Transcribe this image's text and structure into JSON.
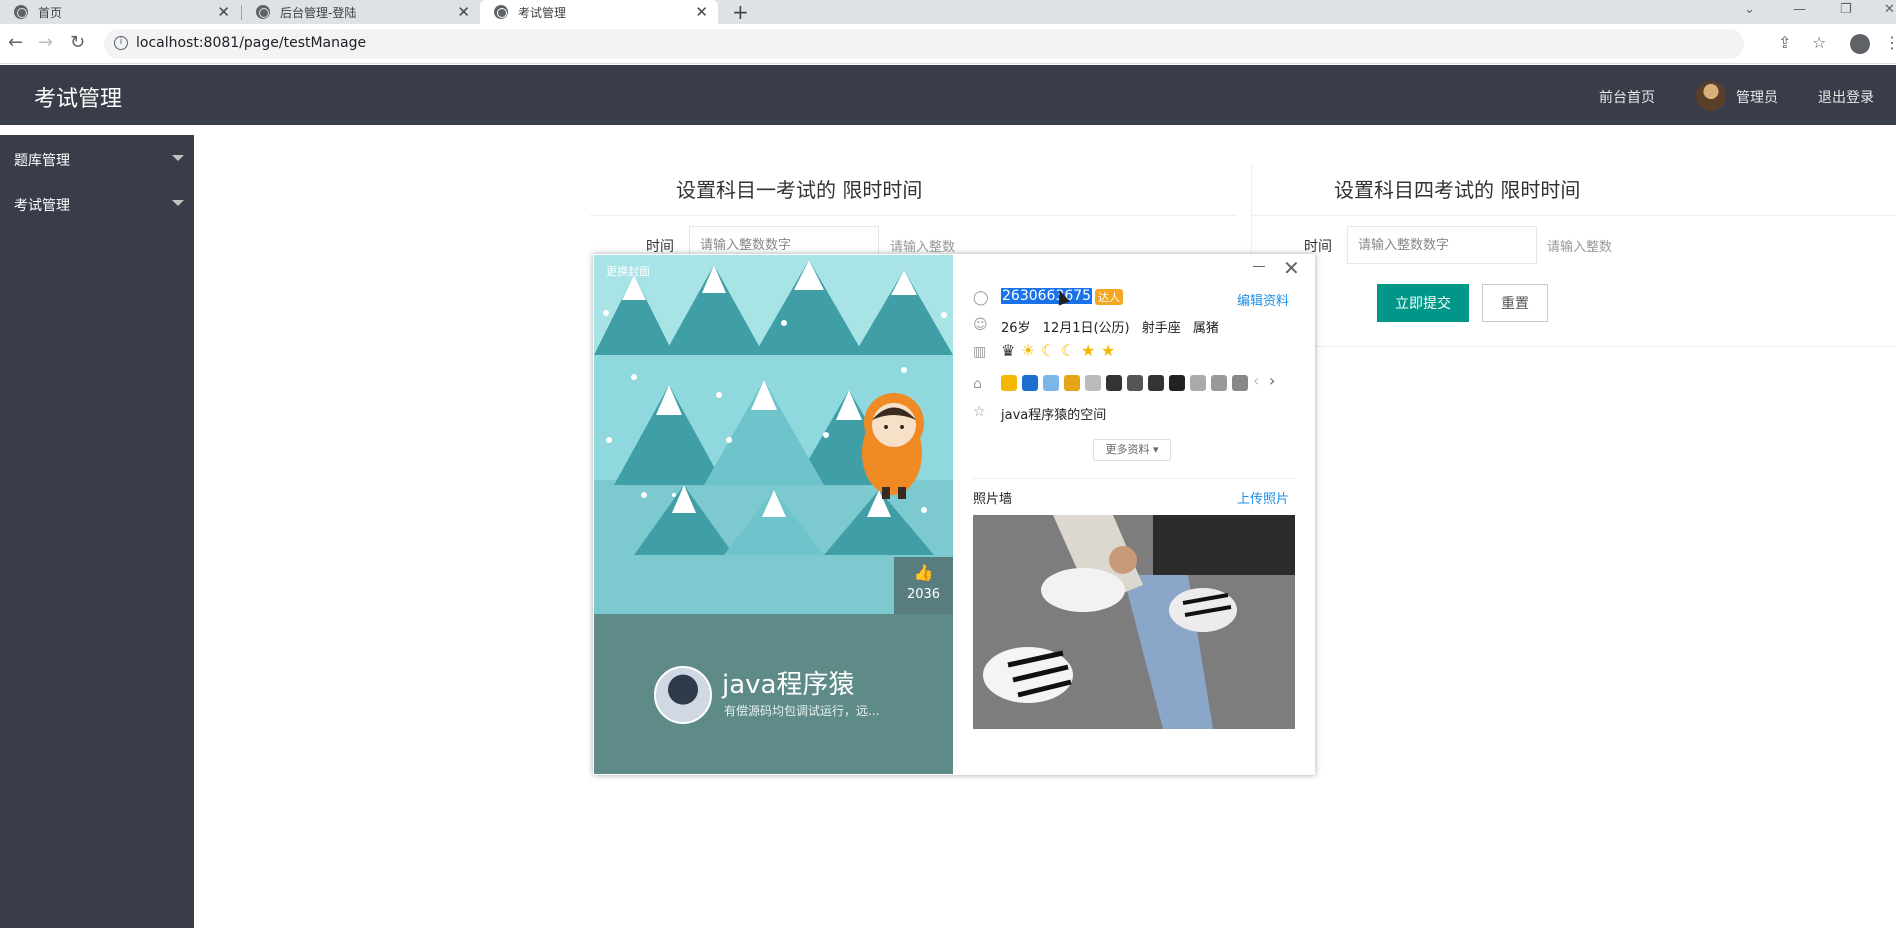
{
  "browser": {
    "tabs": [
      {
        "label": "首页"
      },
      {
        "label": "后台管理-登陆"
      },
      {
        "label": "考试管理"
      }
    ],
    "url": "localhost:8081/page/testManage"
  },
  "header": {
    "title": "考试管理",
    "front_link": "前台首页",
    "user_name": "管理员",
    "logout": "退出登录"
  },
  "sidebar": {
    "items": [
      {
        "label": "题库管理"
      },
      {
        "label": "考试管理"
      }
    ]
  },
  "forms": [
    {
      "title": "设置科目一考试的 限时时间",
      "label": "时间",
      "placeholder": "请输入整数数字",
      "aux": "请输入整数"
    },
    {
      "title": "设置科目四考试的 限时时间",
      "label": "时间",
      "placeholder": "请输入整数数字",
      "aux": "请输入整数",
      "submit": "立即提交",
      "reset": "重置"
    }
  ],
  "qq_card": {
    "skin_label": "更换封面",
    "like_count": "2036",
    "nickname": "java程序猿",
    "signature": "有偿源码均包调试运行，远...",
    "qq_number": "2630663675",
    "vip_badge": "达人",
    "edit_link": "编辑资料",
    "profile_line": "26岁  12月1日(公历)  射手座  属猪",
    "space_link": "java程序猿的空间",
    "more_button": "更多资料 ▾",
    "photo_wall_title": "照片墙",
    "upload_link": "上传照片"
  }
}
